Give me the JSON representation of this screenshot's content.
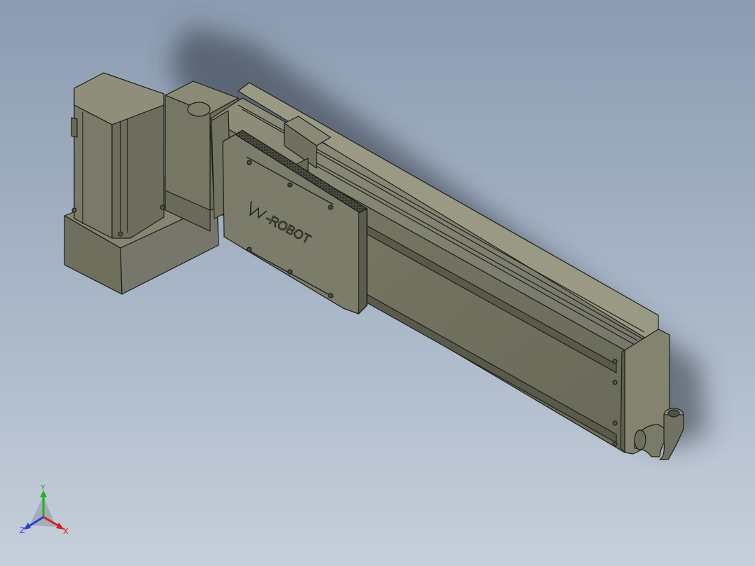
{
  "viewport": {
    "background_top": "#8c9cb1",
    "background_bottom": "#c6cfdb"
  },
  "model": {
    "name": "linear-actuator-with-servo-motor",
    "carriage_logo_text": "-ROBOT",
    "body_color": "#7b7b68",
    "edge_color": "#1e1e1a"
  },
  "triad": {
    "x_label": "X",
    "y_label": "Y",
    "z_label": "Z",
    "x_color": "#d22020",
    "y_color": "#22b022",
    "z_color": "#2a3fd0"
  }
}
